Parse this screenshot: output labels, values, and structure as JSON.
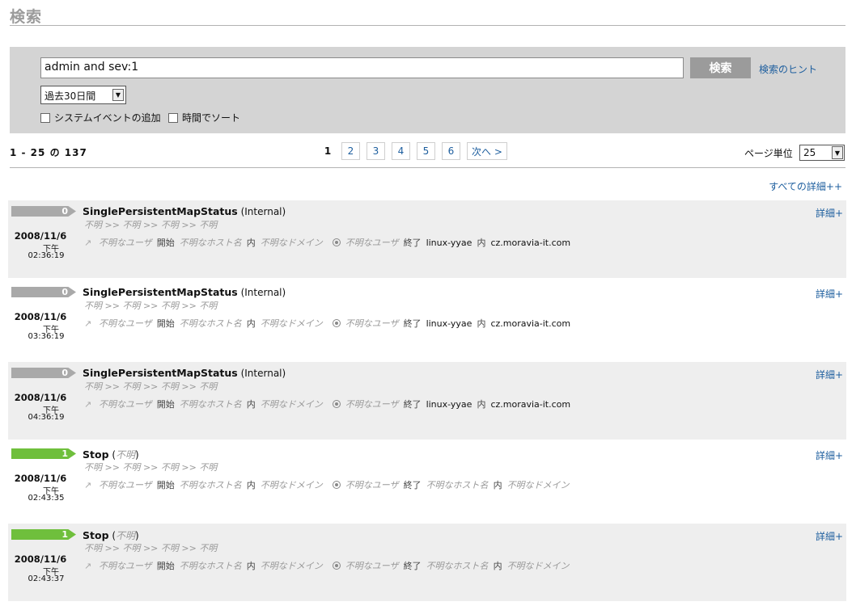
{
  "header": {
    "title": "検索"
  },
  "search": {
    "query": "admin and sev:1",
    "button": "検索",
    "hint": "検索のヒント",
    "range": "過去30日間",
    "opt_system_events": "システムイベントの追加",
    "opt_sort_time": "時間でソート"
  },
  "results": {
    "count": "1 - 25 の 137",
    "current_page": "1",
    "pages": [
      "2",
      "3",
      "4",
      "5",
      "6"
    ],
    "next": "次へ >",
    "page_size_label": "ページ単位",
    "page_size": "25",
    "all_details": "すべての詳細++"
  },
  "labels": {
    "unknown": "不明",
    "sep": ">>",
    "unknown_user": "不明なユーザ",
    "start": "開始",
    "unknown_host": "不明なホスト名",
    "in": "内",
    "unknown_domain": "不明なドメイン",
    "end": "終了",
    "details": "詳細+"
  },
  "events": [
    {
      "severity": "0",
      "color": "#a9a9a9",
      "name": "SinglePersistentMapStatus",
      "source": "(Internal)",
      "date": "2008/11/6",
      "ampm": "下午",
      "time": "02:36:19",
      "target_host": "linux-yyae",
      "target_domain": "cz.moravia-it.com"
    },
    {
      "severity": "0",
      "color": "#a9a9a9",
      "name": "SinglePersistentMapStatus",
      "source": "(Internal)",
      "date": "2008/11/6",
      "ampm": "下午",
      "time": "03:36:19",
      "target_host": "linux-yyae",
      "target_domain": "cz.moravia-it.com"
    },
    {
      "severity": "0",
      "color": "#a9a9a9",
      "name": "SinglePersistentMapStatus",
      "source": "(Internal)",
      "date": "2008/11/6",
      "ampm": "下午",
      "time": "04:36:19",
      "target_host": "linux-yyae",
      "target_domain": "cz.moravia-it.com"
    },
    {
      "severity": "1",
      "color": "#6fbf3c",
      "name": "Stop",
      "source_open": "(",
      "source_mid": "不明",
      "source_close": ")",
      "date": "2008/11/6",
      "ampm": "下午",
      "time": "02:43:35",
      "target_host": "不明なホスト名",
      "target_domain": "不明なドメイン"
    },
    {
      "severity": "1",
      "color": "#6fbf3c",
      "name": "Stop",
      "source_open": "(",
      "source_mid": "不明",
      "source_close": ")",
      "date": "2008/11/6",
      "ampm": "下午",
      "time": "02:43:37",
      "target_host": "不明なホスト名",
      "target_domain": "不明なドメイン"
    }
  ]
}
